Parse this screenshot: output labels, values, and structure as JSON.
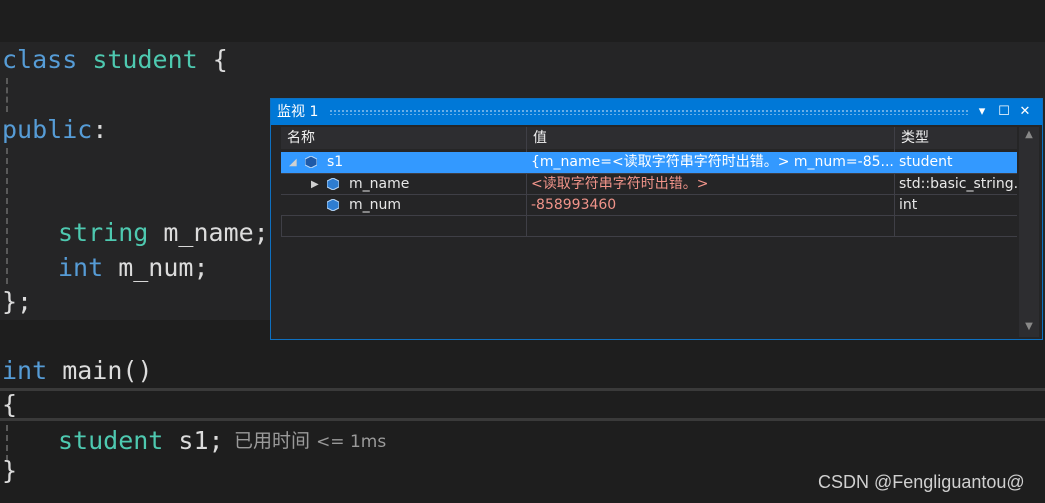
{
  "code": {
    "lines": [
      {
        "kw": "class",
        "ty": "student",
        "rest": " {"
      },
      {
        "kw": "public",
        "rest": ":"
      },
      {
        "ty": "string",
        "rest": " m_name;"
      },
      {
        "kw": "int",
        "rest": " m_num;"
      },
      {
        "rest": "};"
      },
      {
        "kw": "int",
        "rest": " main()"
      },
      {
        "rest": "{"
      },
      {
        "ty": "student",
        "rest": " s1;"
      },
      {
        "rest": "}"
      }
    ],
    "perf_hint": {
      "label": "已用时间",
      "value": "<= 1ms"
    }
  },
  "watch": {
    "title": "监视 1",
    "buttons": {
      "dropdown": "▾",
      "maximize": "☐",
      "close": "✕"
    },
    "columns": [
      "名称",
      "值",
      "类型"
    ],
    "rows": [
      {
        "name": "s1",
        "value": "{m_name=<读取字符串字符时出错。> m_num=-85...",
        "type": "student",
        "expanded": true,
        "selected": true
      },
      {
        "name": "m_name",
        "value": "<读取字符串字符时出错。>",
        "type": "std::basic_string...",
        "expanded": false
      },
      {
        "name": "m_num",
        "value": "-858993460",
        "type": "int"
      }
    ]
  },
  "watermark": "CSDN @Fengliguantou@",
  "colors": {
    "keyword": "#569cd6",
    "type": "#4ec9b0",
    "accent": "#0078d7",
    "selection": "#3399ff",
    "error_value": "#f1948a"
  }
}
